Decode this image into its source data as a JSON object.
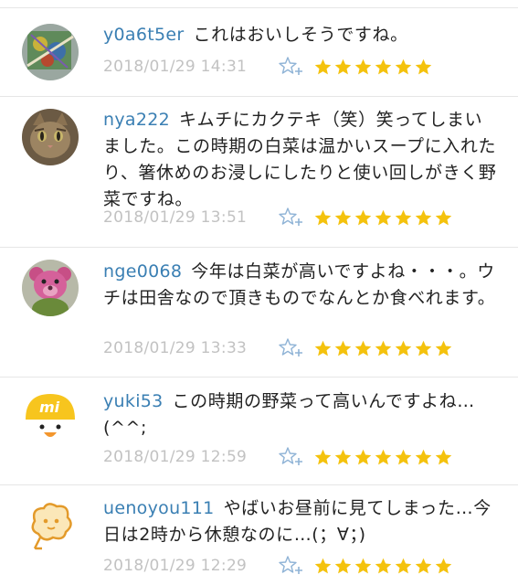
{
  "comments": [
    {
      "username": "y0a6t5er",
      "message": "これはおいしそうですね。",
      "timestamp": "2018/01/29 14:31",
      "star_count": 6,
      "avatar_icon": "painting-avatar-icon"
    },
    {
      "username": "nya222",
      "message": "キムチにカクテキ（笑）笑ってしまいました。この時期の白菜は温かいスープに入れたり、箸休めのお浸しにしたりと使い回しがきく野菜ですね。",
      "timestamp": "2018/01/29 13:51",
      "star_count": 7,
      "avatar_icon": "cat-avatar-icon"
    },
    {
      "username": "nge0068",
      "message": "今年は白菜が高いですよね・・・。ウチは田舎なので頂きものでなんとか食べれます。",
      "timestamp": "2018/01/29 13:33",
      "star_count": 7,
      "avatar_icon": "pink-bear-avatar-icon"
    },
    {
      "username": "yuki53",
      "message": "この時期の野菜って高いんですよね…(^^;",
      "timestamp": "2018/01/29 12:59",
      "star_count": 7,
      "avatar_icon": "yellow-chick-avatar-icon"
    },
    {
      "username": "uenoyou111",
      "message": "やばいお昼前に見てしまった…今日は2時から休憩なのに…(；∀；)",
      "timestamp": "2018/01/29 12:29",
      "star_count": 7,
      "avatar_icon": "cookie-character-avatar-icon"
    }
  ],
  "colors": {
    "username": "#3a7fb3",
    "star": "#f4c20d",
    "timestamp": "#c2c2c2",
    "add_star": "#8fb3d6"
  }
}
